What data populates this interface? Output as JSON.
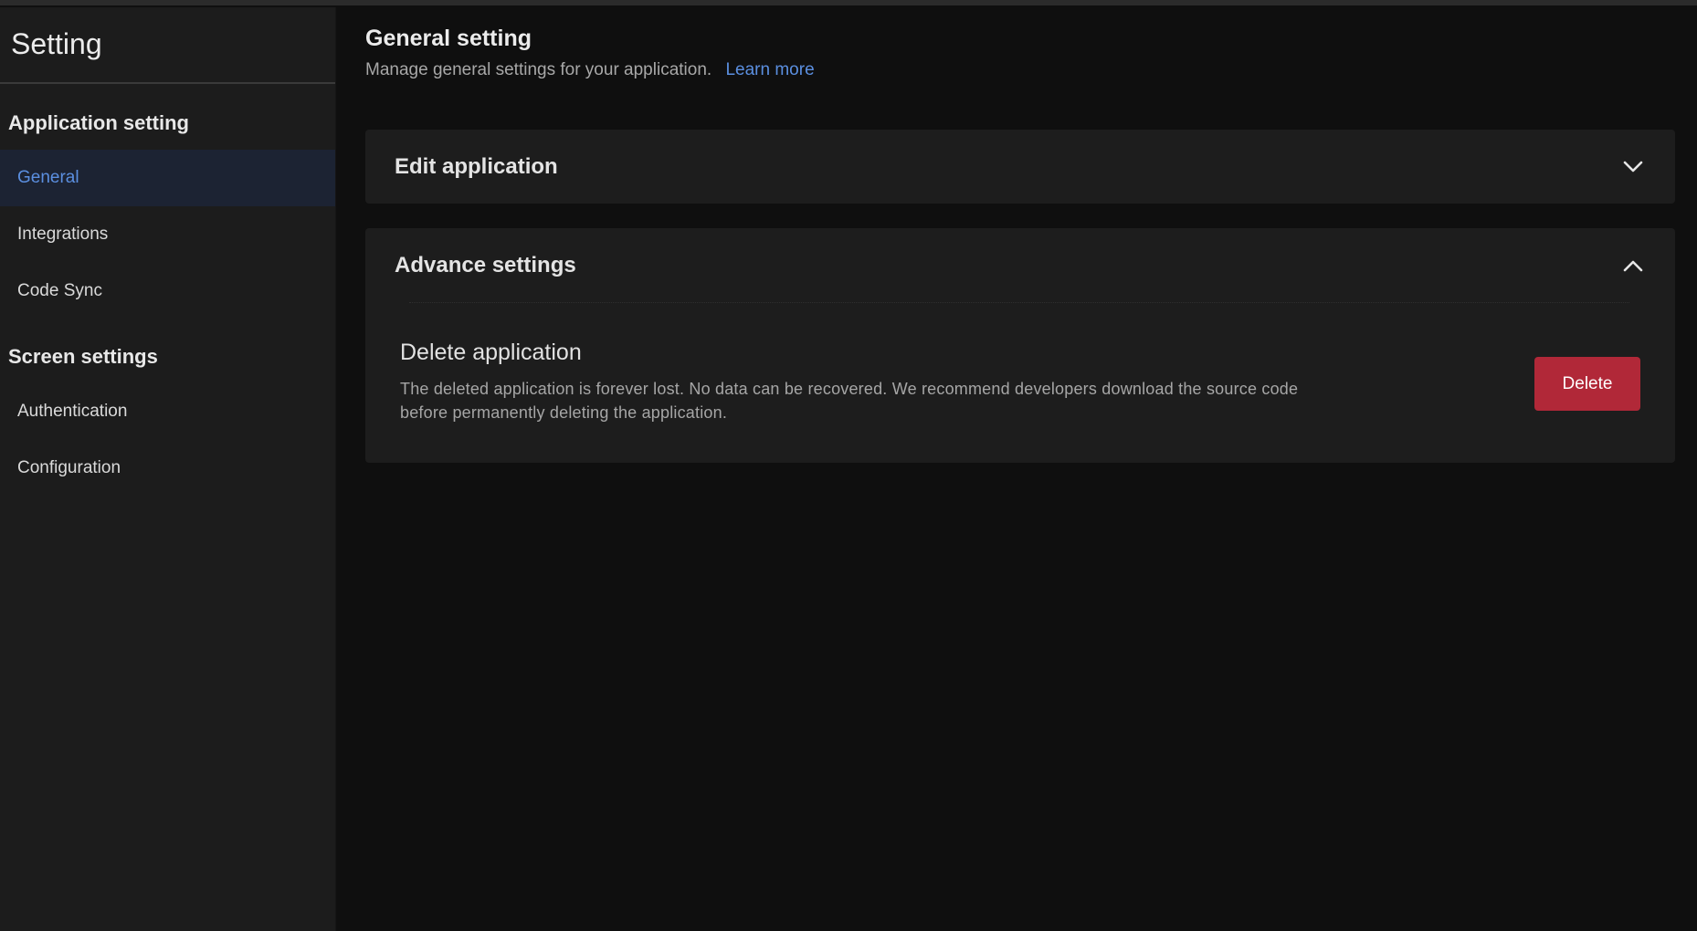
{
  "sidebar": {
    "title": "Setting",
    "sections": [
      {
        "heading": "Application setting",
        "items": [
          {
            "label": "General",
            "active": true
          },
          {
            "label": "Integrations",
            "active": false
          },
          {
            "label": "Code Sync",
            "active": false
          }
        ]
      },
      {
        "heading": "Screen settings",
        "items": [
          {
            "label": "Authentication",
            "active": false
          },
          {
            "label": "Configuration",
            "active": false
          }
        ]
      }
    ]
  },
  "main": {
    "title": "General setting",
    "description": "Manage general settings for your application.",
    "learn_more": "Learn more",
    "panels": {
      "edit": {
        "title": "Edit application",
        "expanded": false,
        "icon": "chevron-down-icon"
      },
      "advance": {
        "title": "Advance settings",
        "expanded": true,
        "icon": "chevron-up-icon",
        "delete": {
          "title": "Delete application",
          "description": "The deleted application is forever lost. No data can be recovered. We recommend developers download the source code before permanently deleting the application.",
          "button_label": "Delete"
        }
      }
    }
  },
  "colors": {
    "accent": "#5b8fe0",
    "danger": "#b12838",
    "background": "#0f0f0f",
    "sidebar": "#1c1c1c",
    "panel": "#1d1d1d"
  }
}
